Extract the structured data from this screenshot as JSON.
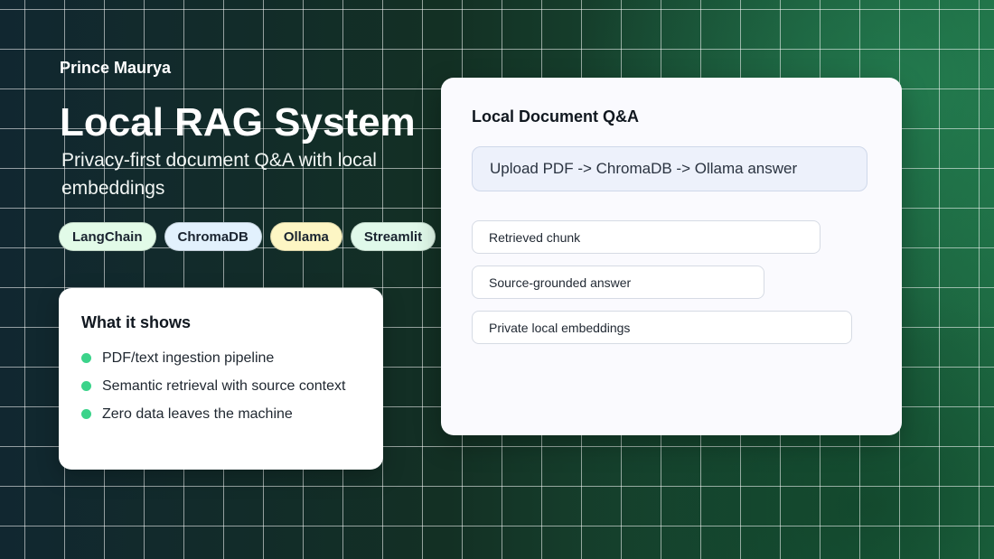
{
  "author": "Prince Maurya",
  "title": "Local RAG System",
  "subtitle": "Privacy-first document Q&A with local embeddings",
  "tags": [
    {
      "label": "LangChain",
      "color": "#e2fbe8"
    },
    {
      "label": "ChromaDB",
      "color": "#e2f1fd"
    },
    {
      "label": "Ollama",
      "color": "#fdf6c4"
    },
    {
      "label": "Streamlit",
      "color": "#e0f9ea"
    }
  ],
  "shows": {
    "title": "What it shows",
    "bullet_color": "#3bd38a",
    "items": [
      "PDF/text ingestion pipeline",
      "Semantic retrieval with source context",
      "Zero data leaves the machine"
    ]
  },
  "qa": {
    "title": "Local Document Q&A",
    "input_text": "Upload PDF -> ChromaDB -> Ollama answer",
    "results": [
      "Retrieved chunk",
      "Source-grounded answer",
      "Private local embeddings"
    ]
  }
}
